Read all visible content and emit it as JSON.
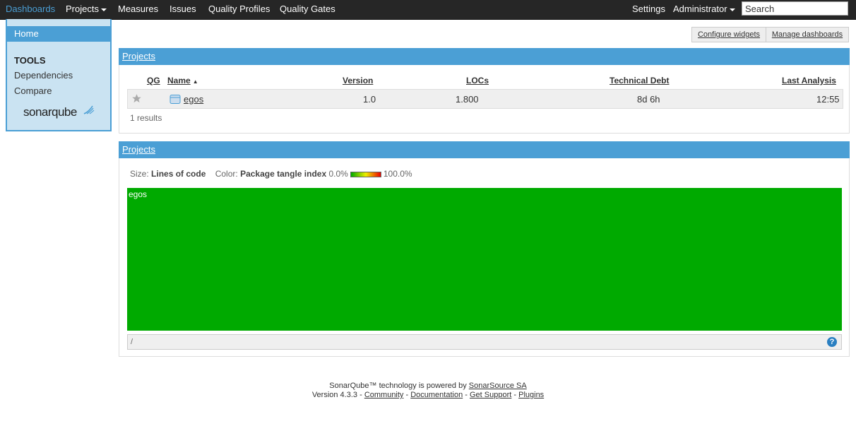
{
  "nav": {
    "items": [
      {
        "label": "Dashboards",
        "active": true
      },
      {
        "label": "Projects",
        "dropdown": true
      },
      {
        "label": "Measures"
      },
      {
        "label": "Issues"
      },
      {
        "label": "Quality Profiles"
      },
      {
        "label": "Quality Gates"
      }
    ],
    "settings": "Settings",
    "admin": "Administrator",
    "search_placeholder": "Search"
  },
  "sidebar": {
    "home": "Home",
    "tools_heading": "TOOLS",
    "links": [
      "Dependencies",
      "Compare"
    ],
    "logo": "sonarqube"
  },
  "buttons": {
    "configure": "Configure widgets",
    "manage": "Manage dashboards"
  },
  "projects_table": {
    "title": "Projects",
    "columns": {
      "qg": "QG",
      "name": "Name",
      "version": "Version",
      "locs": "LOCs",
      "debt": "Technical Debt",
      "analysis": "Last Analysis"
    },
    "rows": [
      {
        "name": "egos",
        "version": "1.0",
        "locs": "1.800",
        "debt": "8d 6h",
        "analysis": "12:55"
      }
    ],
    "results": "1 results"
  },
  "treemap": {
    "title": "Projects",
    "size_label": "Size:",
    "size_metric": "Lines of code",
    "color_label": "Color:",
    "color_metric": "Package tangle index",
    "min": "0.0%",
    "max": "100.0%",
    "cell_label": "egos",
    "breadcrumb": "/",
    "help": "?"
  },
  "footer": {
    "line1_text": "SonarQube™ technology is powered by ",
    "line1_link": "SonarSource SA",
    "version": "Version 4.3.3",
    "sep": " - ",
    "links": [
      "Community",
      "Documentation",
      "Get Support",
      "Plugins"
    ]
  },
  "colors": {
    "accent": "#4b9fd5",
    "treemap_fill": "#00aa00",
    "nav_bg": "#262626"
  }
}
